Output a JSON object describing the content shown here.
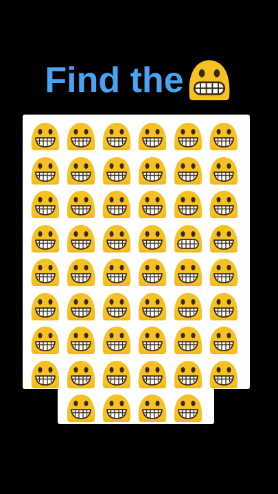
{
  "title": {
    "text": "Find the",
    "emoji_icon": "grimacing-face-icon",
    "color": "#4aa3f2"
  },
  "puzzle": {
    "common_icon": "grinning-face-icon",
    "odd_icon": "grimacing-face-icon",
    "face_color": "#f6c223",
    "face_shade": "#e8a81a",
    "rows": [
      [
        "grin",
        "grin",
        "grin",
        "grin",
        "grin",
        "grin"
      ],
      [
        "grin",
        "grin",
        "grin",
        "grin",
        "grin",
        "grin"
      ],
      [
        "grin",
        "grin",
        "grin",
        "grin",
        "grin",
        "grin"
      ],
      [
        "grin",
        "grin",
        "grin",
        "grin",
        "grimace",
        "grin"
      ],
      [
        "grin",
        "grin",
        "grin",
        "grin",
        "grin",
        "grin"
      ],
      [
        "grin",
        "grin",
        "grin",
        "grin",
        "grin",
        "grin"
      ],
      [
        "grin",
        "grin",
        "grin",
        "grin",
        "grin",
        "grin"
      ],
      [
        "grin",
        "grin",
        "grin",
        "grin",
        "grin",
        "grin"
      ],
      [
        "",
        "grin",
        "grin",
        "grin",
        "grin",
        ""
      ]
    ]
  }
}
